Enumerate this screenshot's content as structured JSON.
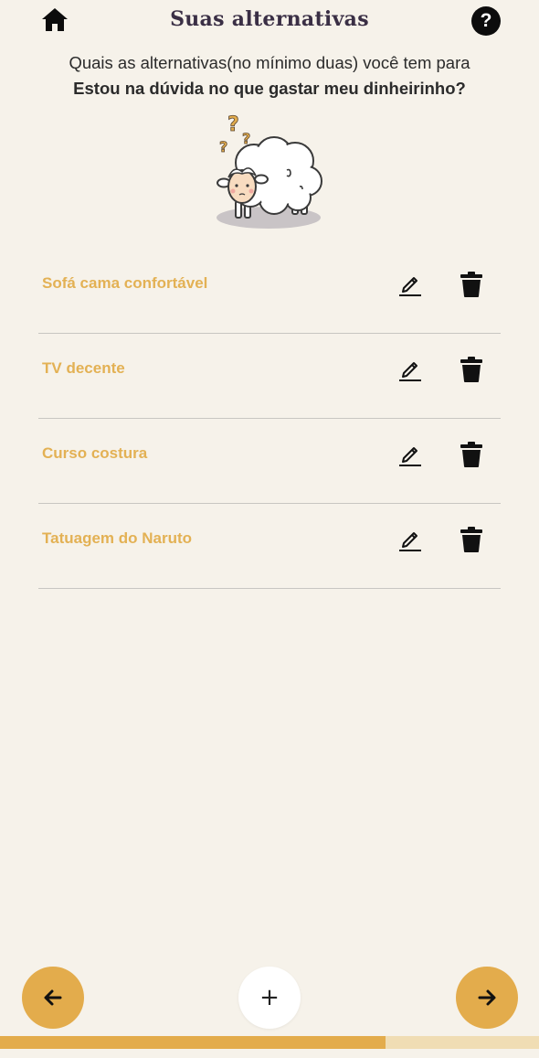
{
  "header": {
    "title": "Suas alternativas",
    "help_label": "?"
  },
  "prompt": {
    "subtitle": "Quais as alternativas(no mínimo duas) você tem para",
    "question": "Estou na dúvida no que gastar meu dinheirinho?"
  },
  "illustration": {
    "question_marks": [
      "?",
      "?",
      "?"
    ]
  },
  "alternatives": [
    {
      "label": "Sofá cama confortável"
    },
    {
      "label": "TV decente"
    },
    {
      "label": "Curso costura"
    },
    {
      "label": "Tatuagem do Naruto"
    }
  ],
  "footer": {
    "add_label": "+"
  },
  "progress": {
    "fraction": 0.715
  },
  "colors": {
    "accent": "#e3ac4c",
    "item_text": "#e3b154",
    "background": "#f6f2ea",
    "progress_track": "#f0ddb4"
  },
  "icons": {
    "home": "home-icon",
    "help": "question-icon",
    "edit": "pencil-icon",
    "delete": "trash-icon",
    "back": "arrow-left-icon",
    "add": "plus-icon",
    "next": "arrow-right-icon"
  }
}
